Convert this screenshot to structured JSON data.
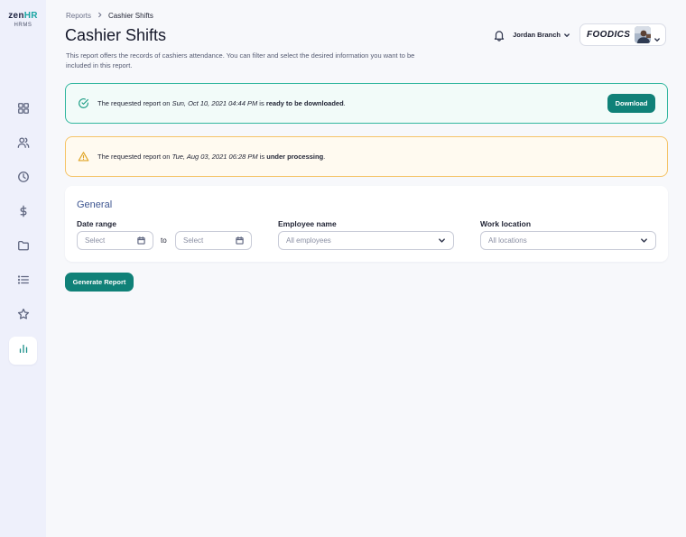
{
  "app": {
    "logo_main": "zen",
    "logo_accent": "HR",
    "logo_sub": "HRMS"
  },
  "sidebar": {
    "items": [
      {
        "icon": "grid-icon",
        "active": false
      },
      {
        "icon": "users-icon",
        "active": false
      },
      {
        "icon": "clock-icon",
        "active": false
      },
      {
        "icon": "dollar-icon",
        "active": false
      },
      {
        "icon": "folder-icon",
        "active": false
      },
      {
        "icon": "list-icon",
        "active": false
      },
      {
        "icon": "star-icon",
        "active": false
      },
      {
        "icon": "bar-chart-icon",
        "active": true
      }
    ]
  },
  "breadcrumb": {
    "parent": "Reports",
    "separator": ">",
    "current": "Cashier Shifts"
  },
  "page": {
    "title": "Cashier Shifts",
    "description": "This report offers the records of cashiers attendance. You can filter and select the desired information you want to be included in this report."
  },
  "header": {
    "user_name": "Jordan Branch",
    "company_name": "FOODICS"
  },
  "alerts": {
    "success": {
      "prefix": "The requested report on ",
      "date": "Sun, Oct 10, 2021 04:44 PM",
      "middle": " is ",
      "status": "ready to be downloaded",
      "suffix": ".",
      "button": "Download"
    },
    "warning": {
      "prefix": "The requested report on ",
      "date": "Tue, Aug 03, 2021 06:28 PM",
      "middle": " is ",
      "status": "under processing",
      "suffix": "."
    }
  },
  "filters": {
    "section_title": "General",
    "date_range": {
      "label": "Date range",
      "from_placeholder": "Select",
      "to_label": "to",
      "to_placeholder": "Select"
    },
    "employee": {
      "label": "Employee name",
      "placeholder": "All employees"
    },
    "location": {
      "label": "Work location",
      "placeholder": "All locations"
    }
  },
  "actions": {
    "generate": "Generate Report"
  },
  "colors": {
    "accent": "#108178",
    "success_border": "#32b79f",
    "warning_border": "#f5c468",
    "section_title": "#3d5590"
  }
}
